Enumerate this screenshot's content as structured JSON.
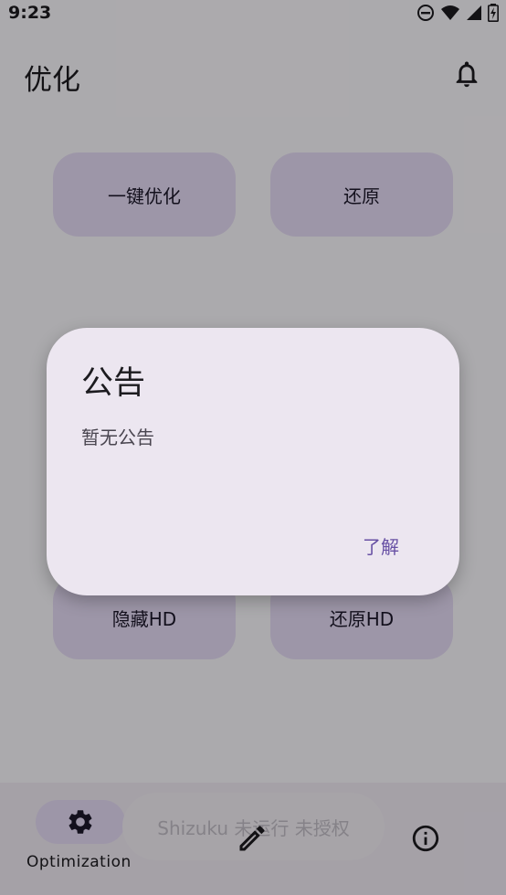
{
  "status_bar": {
    "time": "9:23"
  },
  "app_bar": {
    "title": "优化"
  },
  "tiles": {
    "one_click": "一键优化",
    "restore": "还原",
    "hide_hd": "隐藏HD",
    "restore_hd": "还原HD"
  },
  "bottom_nav": {
    "optimization_label": "Optimization"
  },
  "snackbar": {
    "text": "Shizuku 未运行 未授权"
  },
  "dialog": {
    "title": "公告",
    "body": "暂无公告",
    "confirm_label": "了解"
  },
  "colors": {
    "primary": "#6750a4",
    "tile_bg": "#e8def8",
    "dialog_bg": "#ece6f0",
    "scrim": "rgba(0,0,0,0.32)"
  }
}
